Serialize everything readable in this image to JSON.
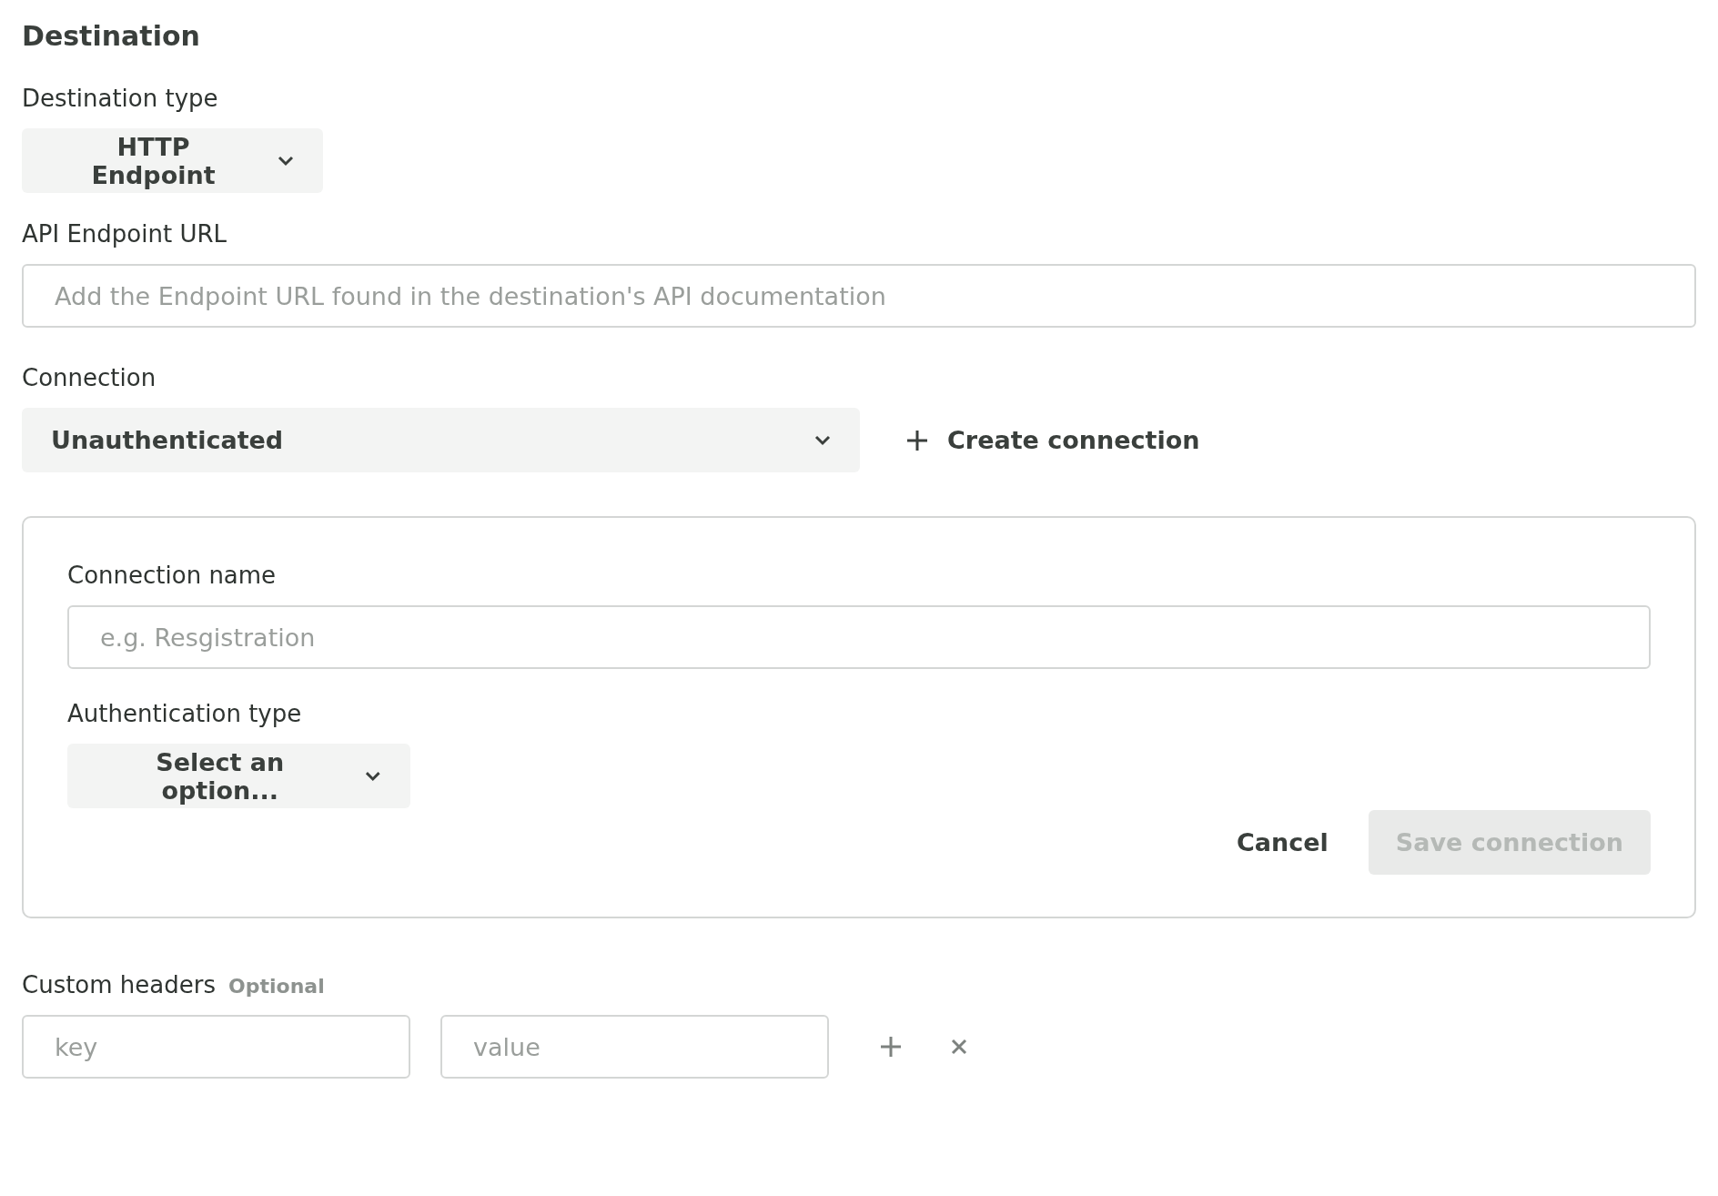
{
  "title": "Destination",
  "destination_type": {
    "label": "Destination type",
    "value": "HTTP Endpoint"
  },
  "api_endpoint_url": {
    "label": "API Endpoint URL",
    "placeholder": "Add the Endpoint URL found in the destination's API documentation"
  },
  "connection": {
    "label": "Connection",
    "value": "Unauthenticated",
    "create_button": "Create connection"
  },
  "connection_panel": {
    "name_label": "Connection name",
    "name_placeholder": "e.g. Resgistration",
    "auth_label": "Authentication type",
    "auth_value": "Select an option...",
    "cancel_button": "Cancel",
    "save_button": {
      "label": "Save connection",
      "disabled": true
    }
  },
  "custom_headers": {
    "label": "Custom headers",
    "badge": "Optional",
    "key_placeholder": "key",
    "value_placeholder": "value"
  }
}
